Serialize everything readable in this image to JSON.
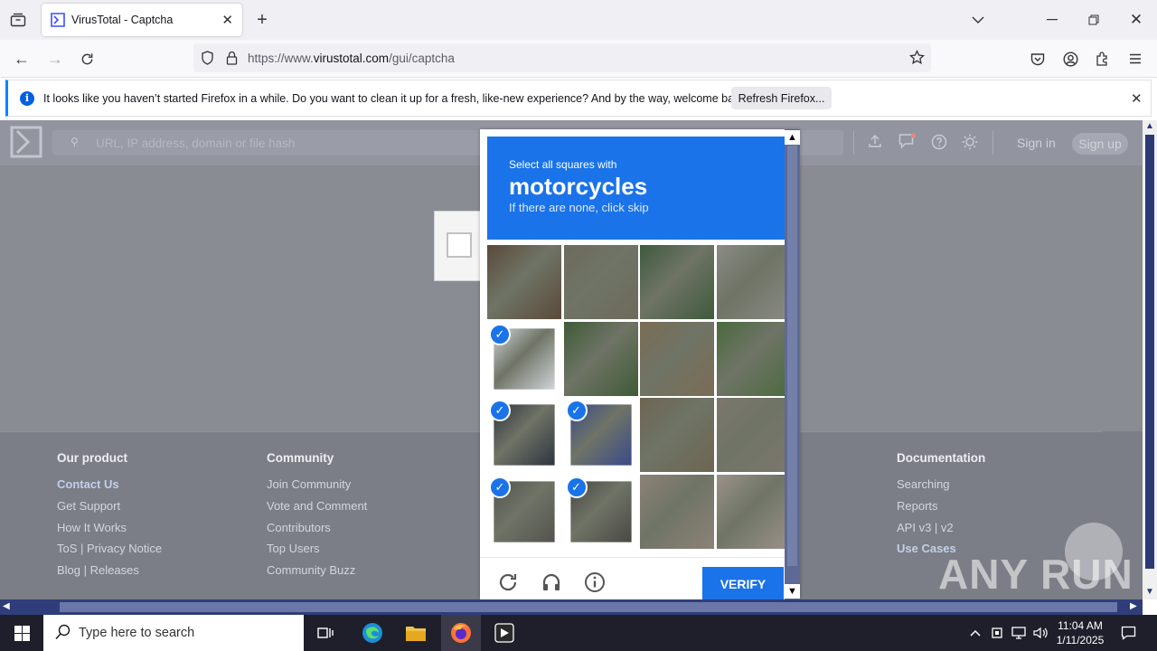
{
  "browser": {
    "tab_title": "VirusTotal - Captcha",
    "url_prefix": "https://www.",
    "url_domain": "virustotal.com",
    "url_path": "/gui/captcha"
  },
  "notification": {
    "text": "It looks like you haven’t started Firefox in a while. Do you want to clean it up for a fresh, like-new experience? And by the way, welcome back!",
    "button": "Refresh Firefox..."
  },
  "vt": {
    "search_placeholder": "URL, IP address, domain or file hash",
    "sign_in": "Sign in",
    "sign_up": "Sign up"
  },
  "footer": {
    "product": {
      "title": "Our product",
      "items": [
        "Contact Us",
        "Get Support",
        "How It Works",
        "ToS | Privacy Notice",
        "Blog | Releases"
      ]
    },
    "community": {
      "title": "Community",
      "items": [
        "Join Community",
        "Vote and Comment",
        "Contributors",
        "Top Users",
        "Community Buzz"
      ]
    },
    "documentation": {
      "title": "Documentation",
      "items": [
        "Searching",
        "Reports",
        "API v3 | v2",
        "Use Cases"
      ]
    }
  },
  "captcha": {
    "instruction": "Select all squares with",
    "target": "motorcycles",
    "hint": "If there are none, click skip",
    "verify": "VERIFY",
    "selected_tiles": [
      4,
      8,
      9,
      12,
      13
    ]
  },
  "taskbar": {
    "search_placeholder": "Type here to search",
    "time": "11:04 AM",
    "date": "1/11/2025"
  },
  "watermark": "ANY RUN"
}
